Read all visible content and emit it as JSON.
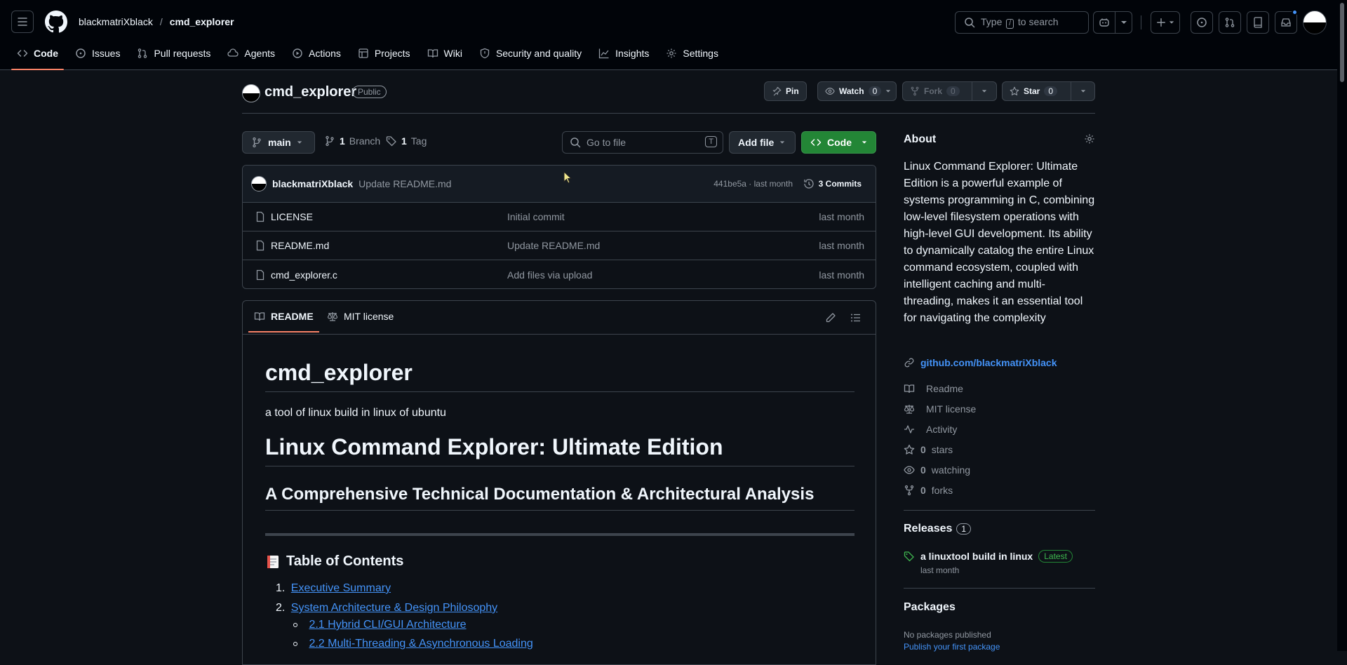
{
  "header": {
    "owner": "blackmatriXblack",
    "repo": "cmd_explorer",
    "search_pre": "Type",
    "search_key": "/",
    "search_post": "to search"
  },
  "nav": {
    "tabs": [
      {
        "label": "Code",
        "icon": "code-icon"
      },
      {
        "label": "Issues",
        "icon": "issue-icon"
      },
      {
        "label": "Pull requests",
        "icon": "pull-request-icon"
      },
      {
        "label": "Agents",
        "icon": "agent-icon"
      },
      {
        "label": "Actions",
        "icon": "play-icon"
      },
      {
        "label": "Projects",
        "icon": "table-icon"
      },
      {
        "label": "Wiki",
        "icon": "book-icon"
      },
      {
        "label": "Security and quality",
        "icon": "shield-icon"
      },
      {
        "label": "Insights",
        "icon": "graph-icon"
      },
      {
        "label": "Settings",
        "icon": "gear-icon"
      }
    ]
  },
  "repo_head": {
    "name": "cmd_explorer",
    "visibility": "Public",
    "pin": "Pin",
    "watch": "Watch",
    "watch_count": "0",
    "fork": "Fork",
    "fork_count": "0",
    "star": "Star",
    "star_count": "0"
  },
  "toolbar": {
    "branch": "main",
    "branch_count": "1",
    "branch_label": "Branch",
    "tag_count": "1",
    "tag_label": "Tag",
    "goto_placeholder": "Go to file",
    "goto_key": "T",
    "add_file": "Add file",
    "code": "Code"
  },
  "commit": {
    "author": "blackmatriXblack",
    "message": "Update README.md",
    "hash_time": "441be5a · last month",
    "commits": "3 Commits"
  },
  "files": [
    {
      "name": "LICENSE",
      "message": "Initial commit",
      "date": "last month"
    },
    {
      "name": "README.md",
      "message": "Update README.md",
      "date": "last month"
    },
    {
      "name": "cmd_explorer.c",
      "message": "Add files via upload",
      "date": "last month"
    }
  ],
  "readme": {
    "tab_readme": "README",
    "tab_license": "MIT license",
    "h1": "cmd_explorer",
    "intro": "a tool of linux build in linux of ubuntu",
    "h1b": "Linux Command Explorer: Ultimate Edition",
    "h2": "A Comprehensive Technical Documentation & Architectural Analysis",
    "toc_title": "Table of Contents",
    "toc": [
      {
        "num": "1.",
        "label": "Executive Summary"
      },
      {
        "num": "2.",
        "label": "System Architecture & Design Philosophy"
      }
    ],
    "toc_sub": [
      "2.1 Hybrid CLI/GUI Architecture",
      "2.2 Multi-Threading & Asynchronous Loading"
    ]
  },
  "about": {
    "title": "About",
    "description": "Linux Command Explorer: Ultimate Edition is a powerful example of systems programming in C, combining low-level filesystem operations with high-level GUI development. Its ability to dynamically catalog the entire Linux command ecosystem, coupled with intelligent caching and multi-threading, makes it an essential tool for navigating the complexity",
    "link": "github.com/blackmatriXblack",
    "items": [
      {
        "icon": "book-icon",
        "bold": "",
        "text": "Readme"
      },
      {
        "icon": "law-icon",
        "bold": "",
        "text": "MIT license"
      },
      {
        "icon": "pulse-icon",
        "bold": "",
        "text": "Activity"
      },
      {
        "icon": "star-icon",
        "bold": "0",
        "text": "stars"
      },
      {
        "icon": "eye-icon",
        "bold": "0",
        "text": "watching"
      },
      {
        "icon": "fork-icon",
        "bold": "0",
        "text": "forks"
      }
    ]
  },
  "releases": {
    "title": "Releases",
    "count": "1",
    "name": "a linuxtool build in linux",
    "badge": "Latest",
    "date": "last month"
  },
  "packages": {
    "title": "Packages",
    "none": "No packages published",
    "publish": "Publish your first package"
  }
}
